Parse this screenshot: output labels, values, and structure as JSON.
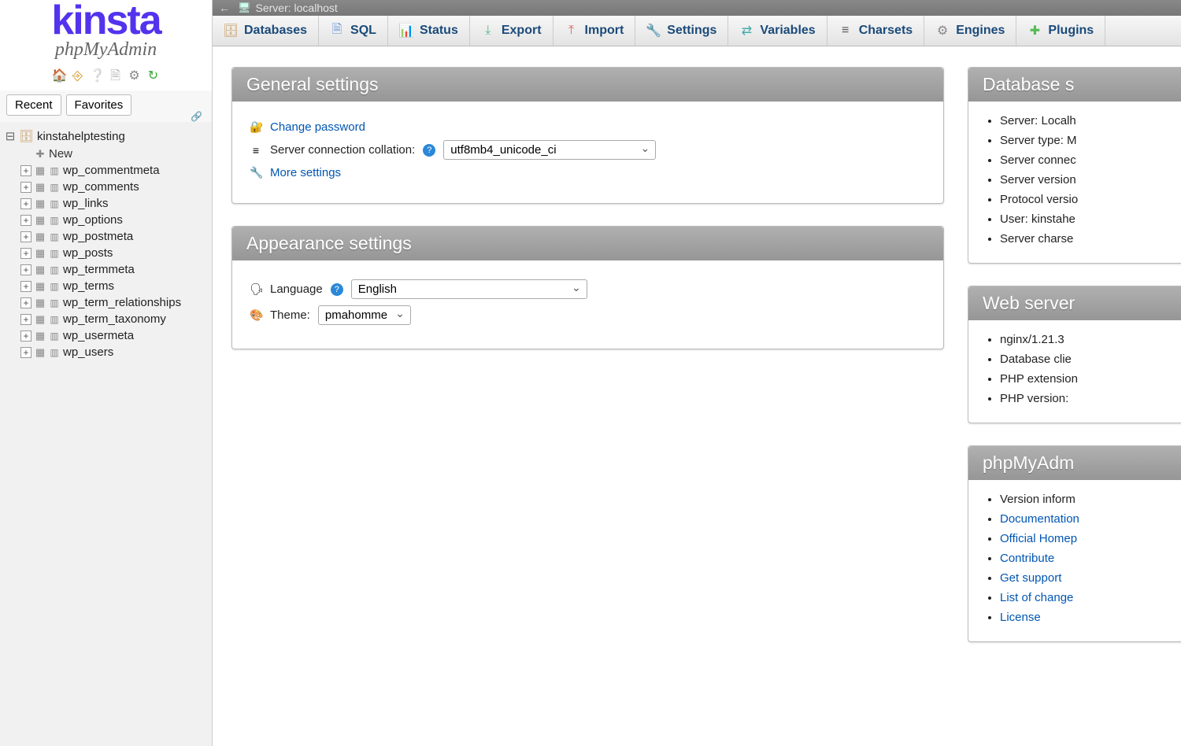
{
  "logo": {
    "brand": "kinsta",
    "product": "phpMyAdmin"
  },
  "sidebar": {
    "recent_label": "Recent",
    "favorites_label": "Favorites",
    "db_name": "kinstahelptesting",
    "new_label": "New",
    "tables": [
      "wp_commentmeta",
      "wp_comments",
      "wp_links",
      "wp_options",
      "wp_postmeta",
      "wp_posts",
      "wp_termmeta",
      "wp_terms",
      "wp_term_relationships",
      "wp_term_taxonomy",
      "wp_usermeta",
      "wp_users"
    ]
  },
  "breadcrumb": {
    "server_label": "Server: localhost"
  },
  "topnav": {
    "items": [
      "Databases",
      "SQL",
      "Status",
      "Export",
      "Import",
      "Settings",
      "Variables",
      "Charsets",
      "Engines",
      "Plugins"
    ]
  },
  "general_settings": {
    "title": "General settings",
    "change_password": "Change password",
    "collation_label": "Server connection collation:",
    "collation_value": "utf8mb4_unicode_ci",
    "more_settings": "More settings"
  },
  "appearance_settings": {
    "title": "Appearance settings",
    "language_label": "Language",
    "language_value": "English",
    "theme_label": "Theme:",
    "theme_value": "pmahomme"
  },
  "database_server": {
    "title": "Database s",
    "items": [
      "Server: Localh",
      "Server type: M",
      "Server connec",
      "Server version",
      "Protocol versio",
      "User: kinstahe",
      "Server charse"
    ]
  },
  "web_server": {
    "title": "Web server",
    "items": [
      "nginx/1.21.3",
      "Database clie",
      "PHP extension",
      "PHP version:"
    ]
  },
  "phpmyadmin_panel": {
    "title": "phpMyAdm",
    "items_text": [
      "Version inform"
    ],
    "items_links": [
      "Documentation",
      "Official Homep",
      "Contribute",
      "Get support",
      "List of change",
      "License"
    ]
  }
}
